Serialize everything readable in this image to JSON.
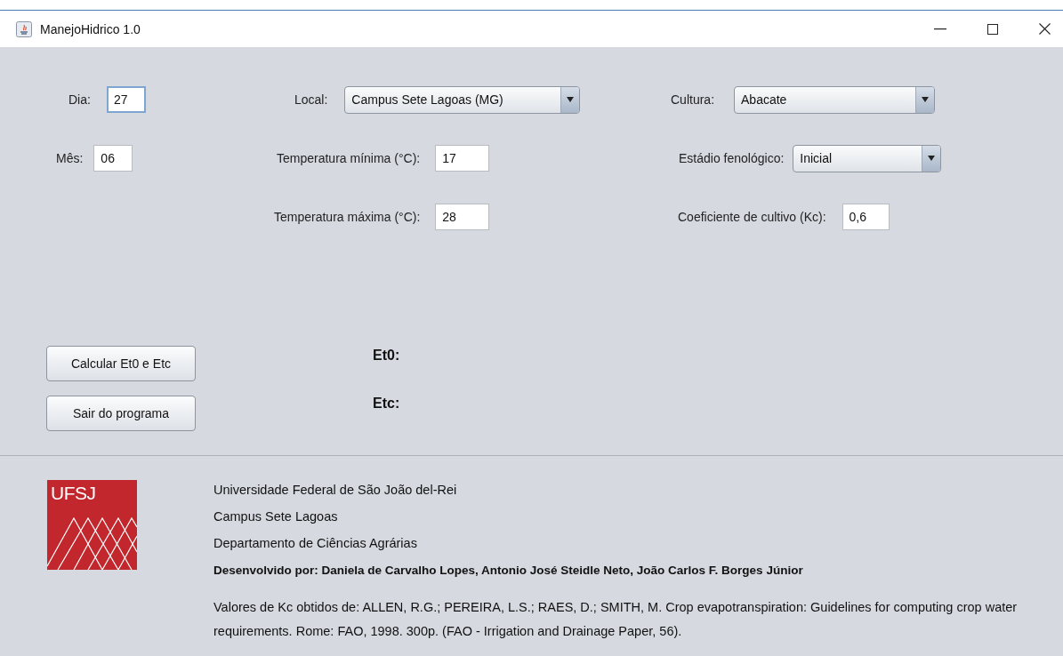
{
  "window": {
    "title": "ManejoHidrico 1.0"
  },
  "form": {
    "column_1": [
      {
        "kind": "text",
        "label": "Dia:",
        "value": "27",
        "focused": true
      },
      {
        "kind": "text",
        "label": "Mês:",
        "value": "06",
        "focused": false
      }
    ],
    "column_2": [
      {
        "kind": "combo",
        "label": "Local:",
        "value": "Campus Sete Lagoas (MG)"
      },
      {
        "kind": "text",
        "label": "Temperatura mínima (°C):",
        "value": "17",
        "focused": false
      },
      {
        "kind": "text",
        "label": "Temperatura máxima (°C):",
        "value": "28",
        "focused": false
      }
    ],
    "column_3": [
      {
        "kind": "combo",
        "label": "Cultura:",
        "value": "Abacate"
      },
      {
        "kind": "combo",
        "label": "Estádio fenológico:",
        "value": "Inicial"
      },
      {
        "kind": "text",
        "label": "Coeficiente de cultivo (Kc):",
        "value": "0,6",
        "focused": false
      }
    ]
  },
  "buttons": [
    "Calcular Et0 e Etc",
    "Sair do programa"
  ],
  "results": [
    {
      "label": "Et0:"
    },
    {
      "label": "Etc:"
    }
  ],
  "footer": {
    "logo_text": "UFSJ",
    "lines": [
      "Universidade Federal de São João del-Rei",
      "Campus Sete Lagoas",
      "Departamento de Ciências Agrárias"
    ],
    "credits": "Desenvolvido por: Daniela de Carvalho Lopes, Antonio José Steidle Neto, João Carlos F. Borges Júnior",
    "reference": "Valores de Kc obtidos de: ALLEN, R.G.; PEREIRA, L.S.; RAES, D.; SMITH, M. Crop evapotranspiration: Guidelines for computing crop water requirements. Rome: FAO, 1998. 300p. (FAO - Irrigation and Drainage Paper, 56)."
  }
}
